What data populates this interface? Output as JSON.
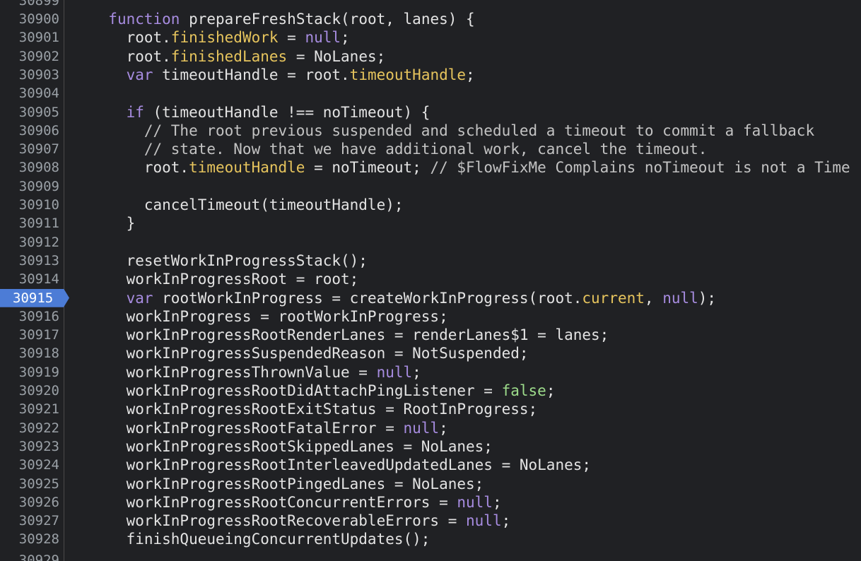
{
  "editor": {
    "active_line": "30915",
    "partial_top_number": "30899",
    "partial_bottom_number": "30929"
  },
  "lines": [
    {
      "n": "30900",
      "tokens": [
        [
          "plain",
          "  "
        ],
        [
          "kw",
          "function"
        ],
        [
          "plain",
          " prepareFreshStack(root, lanes) {"
        ]
      ]
    },
    {
      "n": "30901",
      "tokens": [
        [
          "plain",
          "    root."
        ],
        [
          "prop",
          "finishedWork"
        ],
        [
          "plain",
          " = "
        ],
        [
          "lit",
          "null"
        ],
        [
          "plain",
          ";"
        ]
      ]
    },
    {
      "n": "30902",
      "tokens": [
        [
          "plain",
          "    root."
        ],
        [
          "prop",
          "finishedLanes"
        ],
        [
          "plain",
          " = NoLanes;"
        ]
      ]
    },
    {
      "n": "30903",
      "tokens": [
        [
          "plain",
          "    "
        ],
        [
          "kw",
          "var"
        ],
        [
          "plain",
          " timeoutHandle = root."
        ],
        [
          "prop",
          "timeoutHandle"
        ],
        [
          "plain",
          ";"
        ]
      ]
    },
    {
      "n": "30904",
      "tokens": []
    },
    {
      "n": "30905",
      "tokens": [
        [
          "plain",
          "    "
        ],
        [
          "kw",
          "if"
        ],
        [
          "plain",
          " (timeoutHandle !== noTimeout) {"
        ]
      ]
    },
    {
      "n": "30906",
      "tokens": [
        [
          "cm",
          "      // The root previous suspended and scheduled a timeout to commit a fallback"
        ]
      ]
    },
    {
      "n": "30907",
      "tokens": [
        [
          "cm",
          "      // state. Now that we have additional work, cancel the timeout."
        ]
      ]
    },
    {
      "n": "30908",
      "tokens": [
        [
          "plain",
          "      root."
        ],
        [
          "prop",
          "timeoutHandle"
        ],
        [
          "plain",
          " = noTimeout; "
        ],
        [
          "cm",
          "// $FlowFixMe Complains noTimeout is not a Time"
        ]
      ]
    },
    {
      "n": "30909",
      "tokens": []
    },
    {
      "n": "30910",
      "tokens": [
        [
          "plain",
          "      cancelTimeout(timeoutHandle);"
        ]
      ]
    },
    {
      "n": "30911",
      "tokens": [
        [
          "plain",
          "    }"
        ]
      ]
    },
    {
      "n": "30912",
      "tokens": []
    },
    {
      "n": "30913",
      "tokens": [
        [
          "plain",
          "    resetWorkInProgressStack();"
        ]
      ]
    },
    {
      "n": "30914",
      "tokens": [
        [
          "plain",
          "    workInProgressRoot = root;"
        ]
      ]
    },
    {
      "n": "30915",
      "tokens": [
        [
          "plain",
          "    "
        ],
        [
          "kw",
          "var"
        ],
        [
          "plain",
          " rootWorkInProgress = createWorkInProgress(root."
        ],
        [
          "prop",
          "current"
        ],
        [
          "plain",
          ", "
        ],
        [
          "lit",
          "null"
        ],
        [
          "plain",
          ");"
        ]
      ]
    },
    {
      "n": "30916",
      "tokens": [
        [
          "plain",
          "    workInProgress = rootWorkInProgress;"
        ]
      ]
    },
    {
      "n": "30917",
      "tokens": [
        [
          "plain",
          "    workInProgressRootRenderLanes = renderLanes$1 = lanes;"
        ]
      ]
    },
    {
      "n": "30918",
      "tokens": [
        [
          "plain",
          "    workInProgressSuspendedReason = NotSuspended;"
        ]
      ]
    },
    {
      "n": "30919",
      "tokens": [
        [
          "plain",
          "    workInProgressThrownValue = "
        ],
        [
          "lit",
          "null"
        ],
        [
          "plain",
          ";"
        ]
      ]
    },
    {
      "n": "30920",
      "tokens": [
        [
          "plain",
          "    workInProgressRootDidAttachPingListener = "
        ],
        [
          "bool",
          "false"
        ],
        [
          "plain",
          ";"
        ]
      ]
    },
    {
      "n": "30921",
      "tokens": [
        [
          "plain",
          "    workInProgressRootExitStatus = RootInProgress;"
        ]
      ]
    },
    {
      "n": "30922",
      "tokens": [
        [
          "plain",
          "    workInProgressRootFatalError = "
        ],
        [
          "lit",
          "null"
        ],
        [
          "plain",
          ";"
        ]
      ]
    },
    {
      "n": "30923",
      "tokens": [
        [
          "plain",
          "    workInProgressRootSkippedLanes = NoLanes;"
        ]
      ]
    },
    {
      "n": "30924",
      "tokens": [
        [
          "plain",
          "    workInProgressRootInterleavedUpdatedLanes = NoLanes;"
        ]
      ]
    },
    {
      "n": "30925",
      "tokens": [
        [
          "plain",
          "    workInProgressRootPingedLanes = NoLanes;"
        ]
      ]
    },
    {
      "n": "30926",
      "tokens": [
        [
          "plain",
          "    workInProgressRootConcurrentErrors = "
        ],
        [
          "lit",
          "null"
        ],
        [
          "plain",
          ";"
        ]
      ]
    },
    {
      "n": "30927",
      "tokens": [
        [
          "plain",
          "    workInProgressRootRecoverableErrors = "
        ],
        [
          "lit",
          "null"
        ],
        [
          "plain",
          ";"
        ]
      ]
    },
    {
      "n": "30928",
      "tokens": [
        [
          "plain",
          "    finishQueueingConcurrentUpdates();"
        ]
      ]
    }
  ],
  "colors": {
    "background": "#202124",
    "keyword": "#a78ce0",
    "property": "#e6c45d",
    "boolean": "#9ddc8b",
    "comment": "#c3c3c3",
    "active_line_highlight": "#4c7cd6"
  }
}
